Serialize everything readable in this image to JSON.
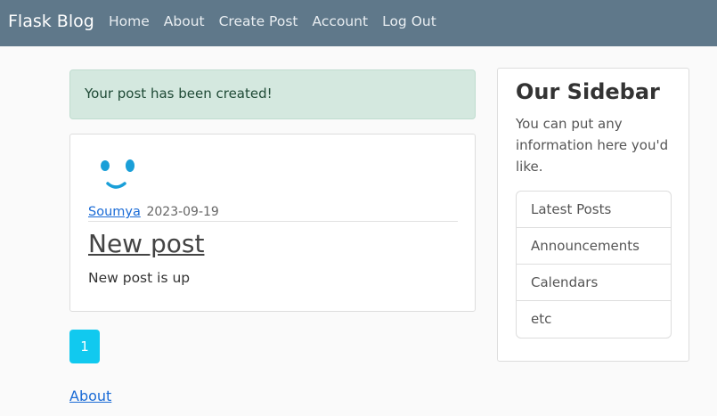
{
  "navbar": {
    "brand": "Flask Blog",
    "links": [
      "Home",
      "About",
      "Create Post",
      "Account",
      "Log Out"
    ]
  },
  "alert": {
    "message": "Your post has been created!"
  },
  "post": {
    "author": "Soumya",
    "date": "2023-09-19",
    "title": "New post",
    "content": "New post is up"
  },
  "pagination": {
    "current_page": "1"
  },
  "footer": {
    "link": "About"
  },
  "sidebar": {
    "title": "Our Sidebar",
    "text": "You can put any information here you'd like.",
    "items": [
      "Latest Posts",
      "Announcements",
      "Calendars",
      "etc"
    ]
  },
  "colors": {
    "navbar": "#5f788a",
    "alert_bg": "#d4e8df",
    "link": "#1a6bd6",
    "page_button": "#11c9ef",
    "avatar": "#1a9fd8"
  }
}
